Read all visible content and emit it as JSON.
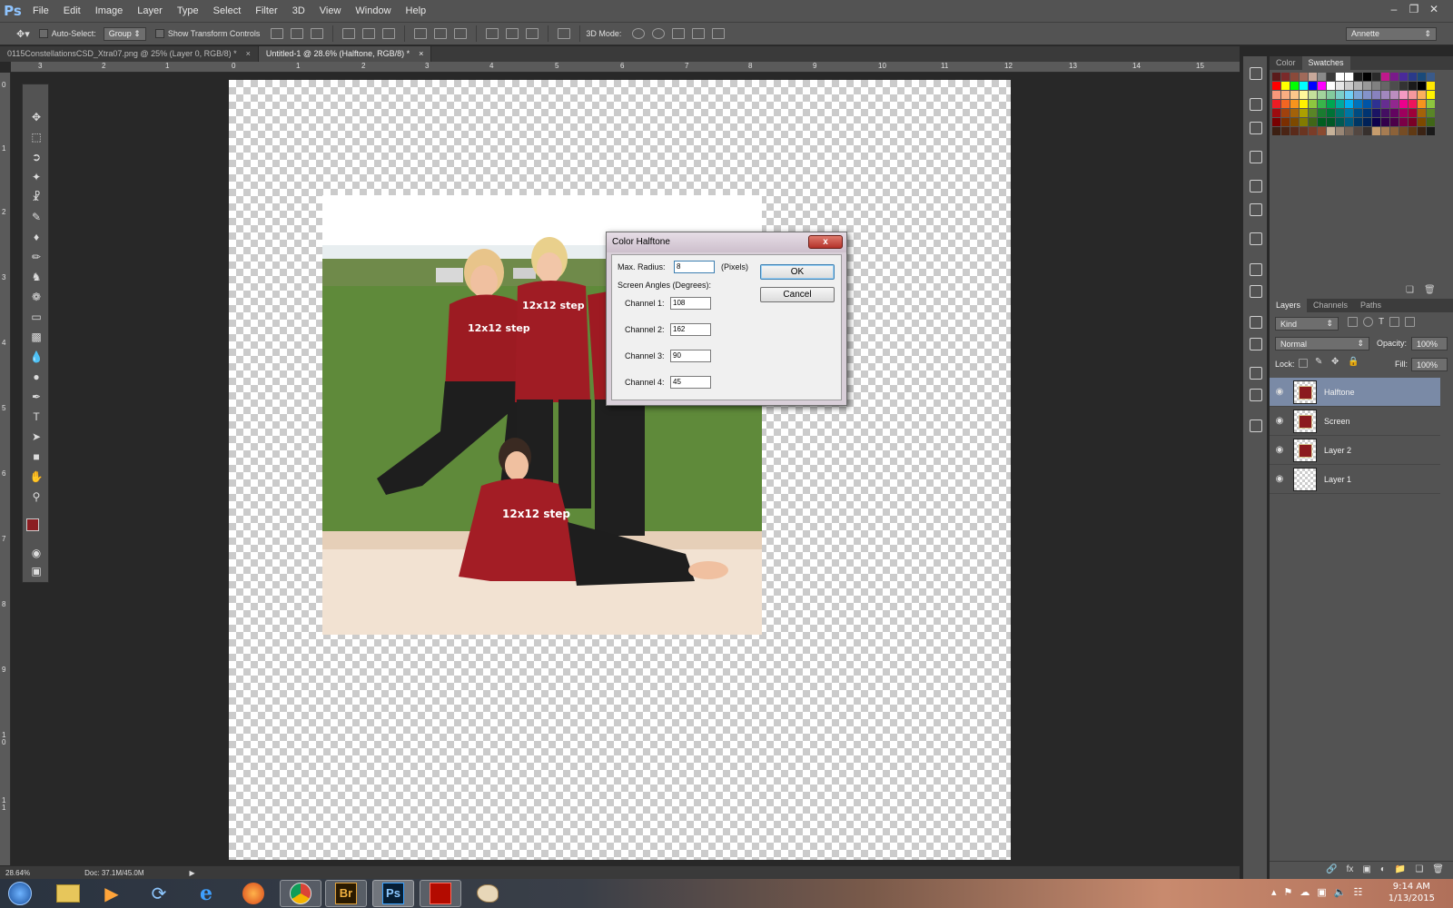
{
  "app": {
    "logo": "Ps"
  },
  "menu": [
    "File",
    "Edit",
    "Image",
    "Layer",
    "Type",
    "Select",
    "Filter",
    "3D",
    "View",
    "Window",
    "Help"
  ],
  "options": {
    "auto_select_label": "Auto-Select:",
    "auto_select_value": "Group",
    "transform_label": "Show Transform Controls",
    "mode_3d_label": "3D Mode:",
    "workspace": "Annette"
  },
  "tabs": [
    {
      "title": "0115ConstellationsCSD_Xtra07.png @ 25% (Layer 0, RGB/8) *",
      "close": "×"
    },
    {
      "title": "Untitled-1 @ 28.6% (Halftone, RGB/8) *",
      "close": "×"
    }
  ],
  "ruler": {
    "top": [
      "3",
      "2",
      "1",
      "0",
      "1",
      "2",
      "3",
      "4",
      "5",
      "6",
      "7",
      "8",
      "9",
      "10",
      "11",
      "12",
      "13",
      "14",
      "15"
    ],
    "left": [
      "0",
      "1",
      "2",
      "3",
      "4",
      "5",
      "6",
      "7",
      "8",
      "9",
      "1\n0",
      "1\n1"
    ]
  },
  "status": {
    "zoom": "28.64%",
    "doc": "Doc: 37.1M/45.0M"
  },
  "dialog": {
    "title": "Color Halftone",
    "close": "x",
    "max_radius_label": "Max. Radius:",
    "max_radius_value": "8",
    "pixels_label": "(Pixels)",
    "screen_angles_label": "Screen Angles (Degrees):",
    "channels": [
      {
        "label": "Channel 1:",
        "value": "108"
      },
      {
        "label": "Channel 2:",
        "value": "162"
      },
      {
        "label": "Channel 3:",
        "value": "90"
      },
      {
        "label": "Channel 4:",
        "value": "45"
      }
    ],
    "ok": "OK",
    "cancel": "Cancel"
  },
  "panels": {
    "color_tabs": [
      "Color",
      "Swatches"
    ],
    "layer_tabs": [
      "Layers",
      "Channels",
      "Paths"
    ],
    "kind": "Kind",
    "blend_mode": "Normal",
    "opacity_label": "Opacity:",
    "opacity_value": "100%",
    "lock_label": "Lock:",
    "fill_label": "Fill:",
    "fill_value": "100%"
  },
  "layers": [
    {
      "name": "Halftone",
      "selected": true,
      "has_image": true
    },
    {
      "name": "Screen",
      "selected": false,
      "has_image": true
    },
    {
      "name": "Layer 2",
      "selected": false,
      "has_image": true
    },
    {
      "name": "Layer 1",
      "selected": false,
      "has_image": false
    }
  ],
  "swatch_colors": [
    "#5a1a1a",
    "#7a2a2a",
    "#8b4a3a",
    "#a06a5a",
    "#c8a89a",
    "#8a8a8a",
    "#3a3a3a",
    "#ffffff",
    "#ffffff",
    "#1a1a1a",
    "#000000",
    "#2a2a2a",
    "#c0188c",
    "#7a1a8a",
    "#4a2a9a",
    "#2a3a8a",
    "#1a4a7a",
    "#3a5a8a",
    "#ff0000",
    "#ffff00",
    "#00ff00",
    "#00ffff",
    "#0000ff",
    "#ff00ff",
    "#ffffff",
    "#e6e6e6",
    "#cccccc",
    "#b3b3b3",
    "#999999",
    "#808080",
    "#666666",
    "#4d4d4d",
    "#333333",
    "#1a1a1a",
    "#000000",
    "#ffe600",
    "#f7977a",
    "#f9ad81",
    "#fdc68a",
    "#fff79a",
    "#c4df9b",
    "#a2d39c",
    "#82ca9d",
    "#7bcdc8",
    "#6ecff6",
    "#7ea7d8",
    "#8493ca",
    "#8882be",
    "#a187be",
    "#bc8dbf",
    "#f49ac2",
    "#f6989d",
    "#fbaf5d",
    "#fff200",
    "#ed1c24",
    "#f26522",
    "#f7941d",
    "#fff200",
    "#8dc63f",
    "#39b54a",
    "#00a651",
    "#00a99d",
    "#00aeef",
    "#0072bc",
    "#0054a6",
    "#2e3192",
    "#662d91",
    "#92278f",
    "#ec008c",
    "#ed145b",
    "#f7941d",
    "#8dc63f",
    "#9e0b0f",
    "#a0410d",
    "#a36209",
    "#aba000",
    "#598527",
    "#1a7b30",
    "#007236",
    "#00746b",
    "#0076a3",
    "#004b80",
    "#003471",
    "#1b1464",
    "#440e62",
    "#630460",
    "#9e005d",
    "#9e0039",
    "#a36209",
    "#598527",
    "#790000",
    "#7b2e00",
    "#7d4900",
    "#827b00",
    "#406618",
    "#005e20",
    "#005826",
    "#005952",
    "#005b7f",
    "#003663",
    "#002157",
    "#0d004c",
    "#32004b",
    "#4b0049",
    "#7b0046",
    "#7a0026",
    "#7d4900",
    "#406618",
    "#3c1f12",
    "#4a2414",
    "#5a2a1a",
    "#6a3420",
    "#7a3c28",
    "#8a4a30",
    "#c7b299",
    "#998675",
    "#736357",
    "#534741",
    "#37302d",
    "#c69c6d",
    "#a67c52",
    "#8c6239",
    "#754c24",
    "#603913",
    "#3b2314",
    "#1a1a1a"
  ],
  "taskbar": {
    "apps": [
      "start",
      "explorer",
      "media",
      "sync",
      "ie",
      "firefox",
      "chrome",
      "bridge",
      "photoshop",
      "acrobat",
      "paint"
    ],
    "bridge_label": "Br",
    "ps_label": "Ps",
    "time": "9:14 AM",
    "date": "1/13/2015"
  }
}
